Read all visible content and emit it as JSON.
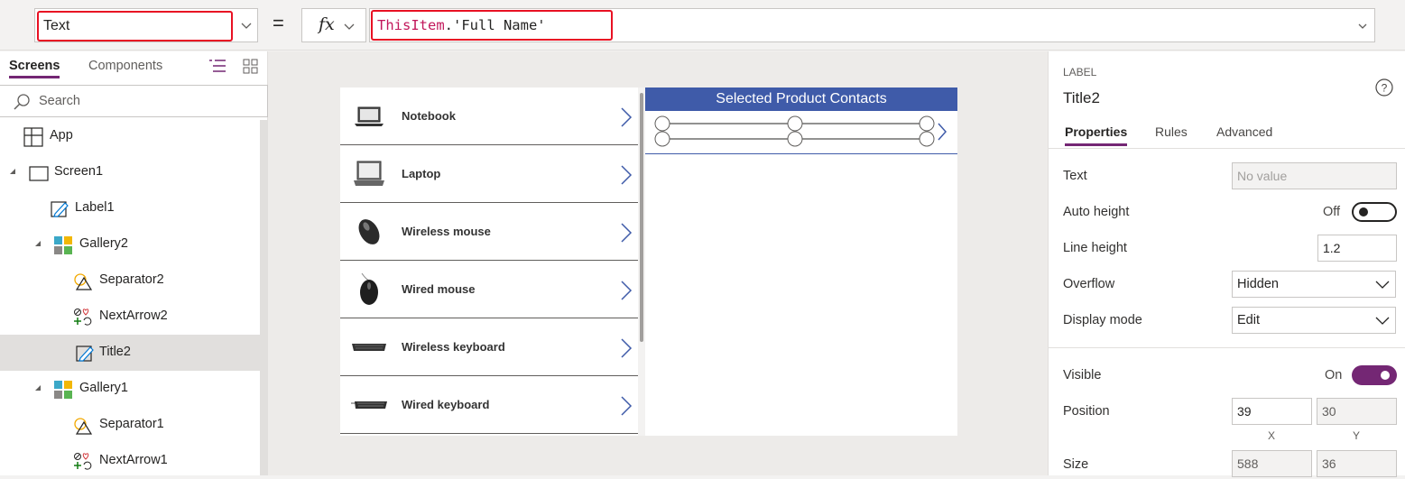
{
  "formula_bar": {
    "property": "Text",
    "equals": "=",
    "fx": "fx",
    "formula_keyword": "ThisItem",
    "formula_rest": ".'Full Name'"
  },
  "tree": {
    "tabs": [
      "Screens",
      "Components"
    ],
    "search_placeholder": "Search",
    "items": [
      {
        "label": "App",
        "icon": "app-icon"
      },
      {
        "label": "Screen1",
        "icon": "screen-icon"
      },
      {
        "label": "Label1",
        "icon": "label-icon"
      },
      {
        "label": "Gallery2",
        "icon": "gallery-icon"
      },
      {
        "label": "Separator2",
        "icon": "shapes-icon"
      },
      {
        "label": "NextArrow2",
        "icon": "icons-icon"
      },
      {
        "label": "Title2",
        "icon": "label-icon",
        "selected": true
      },
      {
        "label": "Gallery1",
        "icon": "gallery-icon"
      },
      {
        "label": "Separator1",
        "icon": "shapes-icon"
      },
      {
        "label": "NextArrow1",
        "icon": "icons-icon"
      }
    ]
  },
  "canvas": {
    "products": [
      "Notebook",
      "Laptop",
      "Wireless mouse",
      "Wired mouse",
      "Wireless keyboard",
      "Wired keyboard"
    ],
    "contacts_header": "Selected Product Contacts"
  },
  "properties": {
    "control_type": "LABEL",
    "control_name": "Title2",
    "tabs": [
      "Properties",
      "Rules",
      "Advanced"
    ],
    "text_label": "Text",
    "text_placeholder": "No value",
    "auto_height_label": "Auto height",
    "auto_height_value": "Off",
    "line_height_label": "Line height",
    "line_height_value": "1.2",
    "overflow_label": "Overflow",
    "overflow_value": "Hidden",
    "display_mode_label": "Display mode",
    "display_mode_value": "Edit",
    "visible_label": "Visible",
    "visible_value": "On",
    "position_label": "Position",
    "position_x": "39",
    "position_y": "30",
    "x_label": "X",
    "y_label": "Y",
    "size_label": "Size",
    "size_w": "588",
    "size_h": "36"
  },
  "colors": {
    "accent": "#742774",
    "highlight": "#e81123",
    "header_blue": "#3f5ba9"
  }
}
